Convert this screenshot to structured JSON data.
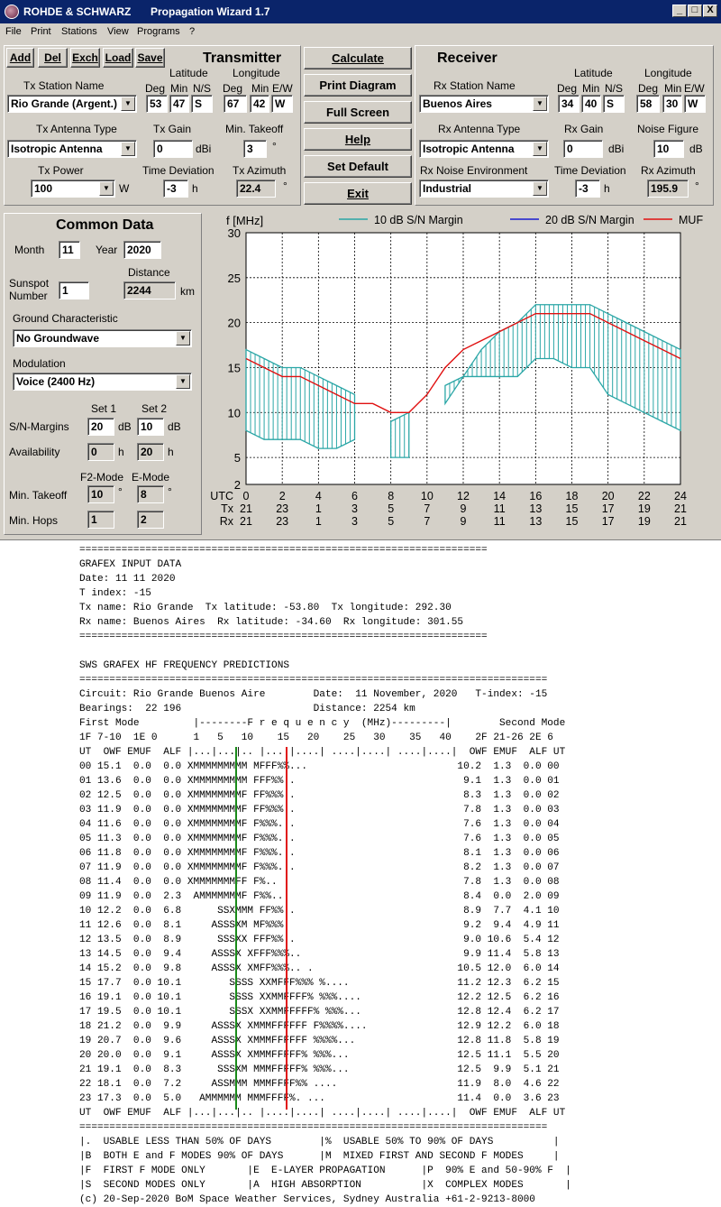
{
  "titlebar": {
    "brand": "ROHDE & SCHWARZ",
    "app": "Propagation Wizard  1.7",
    "min": "_",
    "max": "□",
    "close": "X"
  },
  "menu": [
    "File",
    "Print",
    "Stations",
    "View",
    "Programs",
    "?"
  ],
  "toolbar": {
    "add": "Add",
    "del": "Del",
    "exch": "Exch",
    "load": "Load",
    "save": "Save"
  },
  "actions": {
    "calculate": "Calculate",
    "print": "Print Diagram",
    "full": "Full Screen",
    "help": "Help",
    "default": "Set Default",
    "exit": "Exit"
  },
  "tx": {
    "title": "Transmitter",
    "station_label": "Tx Station Name",
    "station": "Rio Grande (Argent.)",
    "lat_label": "Latitude",
    "lon_label": "Longitude",
    "deg": "Deg",
    "min": "Min",
    "ns": "N/S",
    "ew": "E/W",
    "lat_deg": "53",
    "lat_min": "47",
    "lat_ns": "S",
    "lon_deg": "67",
    "lon_min": "42",
    "lon_ew": "W",
    "ant_label": "Tx Antenna Type",
    "antenna": "Isotropic Antenna",
    "gain_label": "Tx Gain",
    "gain": "0",
    "gain_unit": "dBi",
    "takeoff_label": "Min. Takeoff",
    "takeoff": "3",
    "deg_sym": "°",
    "power_label": "Tx Power",
    "power": "100",
    "power_unit": "W",
    "tdev_label": "Time Deviation",
    "tdev": "-3",
    "h": "h",
    "az_label": "Tx Azimuth",
    "azimuth": "22.4"
  },
  "rx": {
    "title": "Receiver",
    "station_label": "Rx Station Name",
    "station": "Buenos Aires",
    "lat_label": "Latitude",
    "lon_label": "Longitude",
    "deg": "Deg",
    "min": "Min",
    "ns": "N/S",
    "ew": "E/W",
    "lat_deg": "34",
    "lat_min": "40",
    "lat_ns": "S",
    "lon_deg": "58",
    "lon_min": "30",
    "lon_ew": "W",
    "ant_label": "Rx Antenna Type",
    "antenna": "Isotropic Antenna",
    "gain_label": "Rx Gain",
    "gain": "0",
    "gain_unit": "dBi",
    "nf_label": "Noise Figure",
    "nf": "10",
    "nf_unit": "dB",
    "env_label": "Rx Noise Environment",
    "env": "Industrial",
    "tdev_label": "Time Deviation",
    "tdev": "-3",
    "h": "h",
    "az_label": "Rx Azimuth",
    "azimuth": "195.9",
    "deg_sym": "°"
  },
  "common": {
    "title": "Common Data",
    "month_label": "Month",
    "month": "11",
    "year_label": "Year",
    "year": "2020",
    "ssn_label1": "Sunspot",
    "ssn_label2": "Number",
    "ssn": "1",
    "dist_label": "Distance",
    "distance": "2244",
    "km": "km",
    "ground_label": "Ground Characteristic",
    "ground": "No Groundwave",
    "mod_label": "Modulation",
    "modulation": "Voice   (2400 Hz)",
    "set1": "Set 1",
    "set2": "Set 2",
    "sn_label": "S/N-Margins",
    "sn1": "20",
    "sn2": "10",
    "db": "dB",
    "avail_label": "Availability",
    "av1": "0",
    "av2": "20",
    "h": "h",
    "f2": "F2-Mode",
    "emode": "E-Mode",
    "takeoff_label": "Min. Takeoff",
    "to1": "10",
    "to2": "8",
    "deg_sym": "°",
    "hops_label": "Min. Hops",
    "hop1": "1",
    "hop2": "2"
  },
  "chart_data": {
    "type": "line",
    "ylabel": "f [MHz]",
    "ylim": [
      2,
      30
    ],
    "yticks": [
      2,
      5,
      10,
      15,
      20,
      25,
      30
    ],
    "xlim": [
      0,
      24
    ],
    "x": [
      0,
      1,
      2,
      3,
      4,
      5,
      6,
      7,
      8,
      9,
      10,
      11,
      12,
      13,
      14,
      15,
      16,
      17,
      18,
      19,
      20,
      21,
      22,
      23,
      24
    ],
    "x_rows": [
      {
        "label": "UTC",
        "values": [
          "0",
          "2",
          "4",
          "6",
          "8",
          "10",
          "12",
          "14",
          "16",
          "18",
          "20",
          "22",
          "24"
        ]
      },
      {
        "label": "Tx",
        "values": [
          "21",
          "23",
          "1",
          "3",
          "5",
          "7",
          "9",
          "11",
          "13",
          "15",
          "17",
          "19",
          "21"
        ]
      },
      {
        "label": "Rx",
        "values": [
          "21",
          "23",
          "1",
          "3",
          "5",
          "7",
          "9",
          "11",
          "13",
          "15",
          "17",
          "19",
          "21"
        ]
      }
    ],
    "legend": [
      "10 dB S/N Margin",
      "20 dB S/N Margin",
      "MUF"
    ],
    "colors": {
      "s10": "#2aa6a6",
      "s20": "#1a1ad0",
      "muf": "#e01010"
    },
    "muf": [
      [
        0,
        16
      ],
      [
        1,
        15
      ],
      [
        2,
        14
      ],
      [
        3,
        14
      ],
      [
        4,
        13
      ],
      [
        5,
        12
      ],
      [
        6,
        11
      ],
      [
        7,
        11
      ],
      [
        8,
        10
      ],
      [
        9,
        10
      ],
      [
        10,
        12
      ],
      [
        11,
        15
      ],
      [
        12,
        17
      ],
      [
        13,
        18
      ],
      [
        14,
        19
      ],
      [
        15,
        20
      ],
      [
        16,
        21
      ],
      [
        17,
        21
      ],
      [
        18,
        21
      ],
      [
        19,
        21
      ],
      [
        20,
        20
      ],
      [
        21,
        19
      ],
      [
        22,
        18
      ],
      [
        23,
        17
      ],
      [
        24,
        16
      ]
    ],
    "band10": [
      {
        "upper": [
          [
            0,
            17
          ],
          [
            1,
            16
          ],
          [
            2,
            15
          ],
          [
            3,
            15
          ],
          [
            4,
            14
          ],
          [
            5,
            13
          ],
          [
            6,
            12
          ]
        ],
        "lower": [
          [
            0,
            8
          ],
          [
            1,
            7
          ],
          [
            2,
            7
          ],
          [
            3,
            7
          ],
          [
            4,
            6
          ],
          [
            5,
            6
          ],
          [
            6,
            7
          ]
        ]
      },
      {
        "upper": [
          [
            8,
            9
          ],
          [
            9,
            10
          ]
        ],
        "lower": [
          [
            8,
            5
          ],
          [
            9,
            5
          ]
        ]
      },
      {
        "upper": [
          [
            11,
            13
          ],
          [
            12,
            14
          ],
          [
            13,
            17
          ],
          [
            14,
            19
          ],
          [
            15,
            20
          ],
          [
            16,
            22
          ],
          [
            17,
            22
          ],
          [
            18,
            22
          ],
          [
            19,
            22
          ],
          [
            20,
            21
          ],
          [
            21,
            20
          ],
          [
            22,
            19
          ],
          [
            23,
            18
          ],
          [
            24,
            17
          ]
        ],
        "lower": [
          [
            11,
            11
          ],
          [
            12,
            14
          ],
          [
            13,
            14
          ],
          [
            14,
            14
          ],
          [
            15,
            14
          ],
          [
            16,
            16
          ],
          [
            17,
            16
          ],
          [
            18,
            15
          ],
          [
            19,
            15
          ],
          [
            20,
            12
          ],
          [
            21,
            11
          ],
          [
            22,
            10
          ],
          [
            23,
            9
          ],
          [
            24,
            8
          ]
        ]
      }
    ]
  },
  "report": {
    "lines": [
      "====================================================================",
      "GRAFEX INPUT DATA",
      "Date: 11 11 2020",
      "T index: -15",
      "Tx name: Rio Grande  Tx latitude: -53.80  Tx longitude: 292.30",
      "Rx name: Buenos Aires  Rx latitude: -34.60  Rx longitude: 301.55",
      "====================================================================",
      "",
      "SWS GRAFEX HF FREQUENCY PREDICTIONS",
      "==============================================================================",
      "Circuit: Rio Grande Buenos Aire        Date:  11 November, 2020   T-index: -15",
      "Bearings:  22 196                      Distance: 2254 km",
      "First Mode         |--------F r e q u e n c y  (MHz)---------|        Second Mode",
      "1F 7-10  1E 0      1   5   10    15   20    25   30    35   40    2F 21-26 2E 6",
      "UT  OWF EMUF  ALF |...|...|.. |....|....| ....|....| ....|....|  OWF EMUF  ALF UT",
      "00 15.1  0.0  0.0 XMMMMMMMMM MFFF%%...                         10.2  1.3  0.0 00",
      "01 13.6  0.0  0.0 XMMMMMMMMM FFF%%..                            9.1  1.3  0.0 01",
      "02 12.5  0.0  0.0 XMMMMMMMMF FF%%%..                            8.3  1.3  0.0 02",
      "03 11.9  0.0  0.0 XMMMMMMMMF FF%%%..                            7.8  1.3  0.0 03",
      "04 11.6  0.0  0.0 XMMMMMMMMF F%%%...                            7.6  1.3  0.0 04",
      "05 11.3  0.0  0.0 XMMMMMMMMF F%%%...                            7.6  1.3  0.0 05",
      "06 11.8  0.0  0.0 XMMMMMMMMF F%%%...                            8.1  1.3  0.0 06",
      "07 11.9  0.0  0.0 XMMMMMMMMF F%%%...                            8.2  1.3  0.0 07",
      "08 11.4  0.0  0.0 XMMMMMMMFF F%..                               7.8  1.3  0.0 08",
      "09 11.9  0.0  2.3  AMMMMMMMF F%%..                              8.4  0.0  2.0 09",
      "10 12.2  0.0  6.8      SSXMMM FF%%..                            8.9  7.7  4.1 10",
      "11 12.6  0.0  8.1     ASSSXM MF%%%.                             9.2  9.4  4.9 11",
      "12 13.5  0.0  8.9      SSSXX FFF%%..                            9.0 10.6  5.4 12",
      "13 14.5  0.0  9.4     ASSSX XFFF%%%..                           9.9 11.4  5.8 13",
      "14 15.2  0.0  9.8     ASSSX XMFF%%%.. .                        10.5 12.0  6.0 14",
      "15 17.7  0.0 10.1        SSSS XXMFFF%%% %....                  11.2 12.3  6.2 15",
      "16 19.1  0.0 10.1        SSSS XXMMFFFF% %%%....                12.2 12.5  6.2 16",
      "17 19.5  0.0 10.1        SSSX XXMMFFFFF% %%%...                12.8 12.4  6.2 17",
      "18 21.2  0.0  9.9     ASSSX XMMMFFFFFF F%%%%....               12.9 12.2  6.0 18",
      "19 20.7  0.0  9.6     ASSSX XMMMFFFFFF %%%%...                 12.8 11.8  5.8 19",
      "20 20.0  0.0  9.1     ASSSX XMMMFFFFF% %%%...                  12.5 11.1  5.5 20",
      "21 19.1  0.0  8.3      SSSXM MMMFFFFF% %%%...                  12.5  9.9  5.1 21",
      "22 18.1  0.0  7.2     ASSMMM MMMFFFF%% ....                    11.9  8.0  4.6 22",
      "23 17.3  0.0  5.0   AMMMMMM MMMFFFF%. ...                      11.4  0.0  3.6 23",
      "UT  OWF EMUF  ALF |...|...|.. |....|....| ....|....| ....|....|  OWF EMUF  ALF UT",
      "==============================================================================",
      "|.  USABLE LESS THAN 50% OF DAYS        |%  USABLE 50% TO 90% OF DAYS          |",
      "|B  BOTH E and F MODES 90% OF DAYS      |M  MIXED FIRST AND SECOND F MODES     |",
      "|F  FIRST F MODE ONLY       |E  E-LAYER PROPAGATION      |P  90% E and 50-90% F  |",
      "|S  SECOND MODES ONLY       |A  HIGH ABSORPTION          |X  COMPLEX MODES       |",
      "(c) 20-Sep-2020 BoM Space Weather Services, Sydney Australia +61-2-9213-8000"
    ]
  }
}
